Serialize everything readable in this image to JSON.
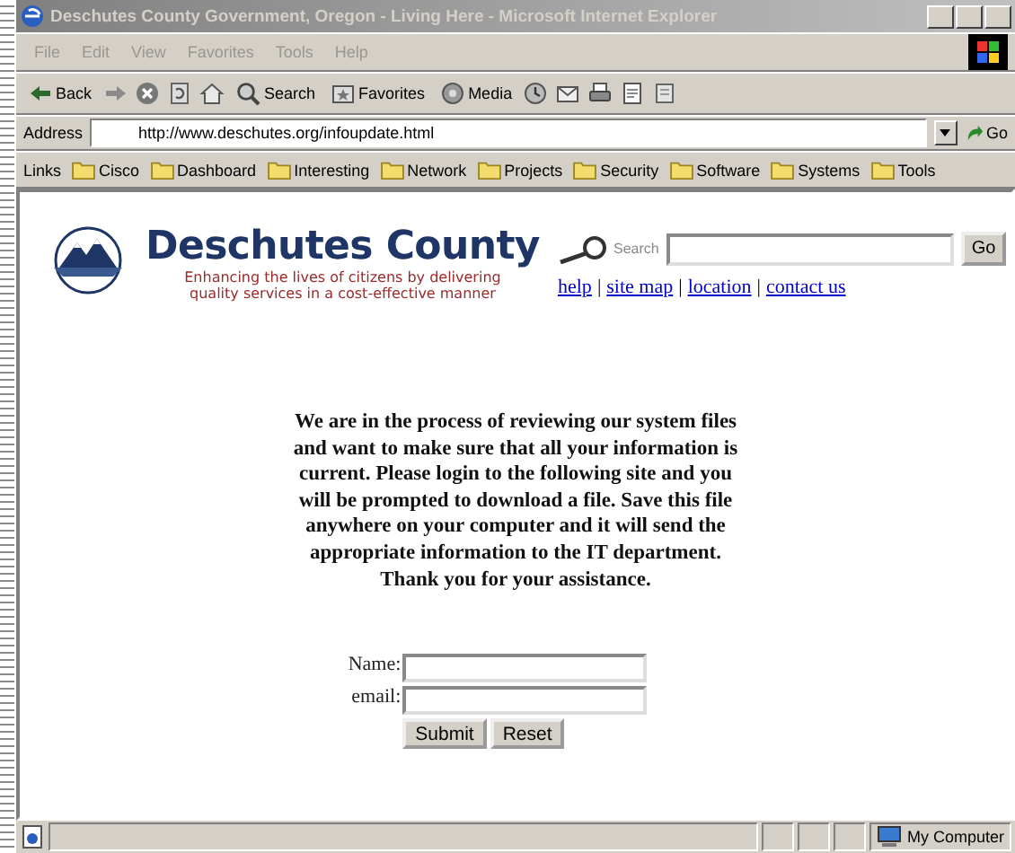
{
  "window": {
    "title": "Deschutes County Government, Oregon - Living Here - Microsoft Internet Explorer"
  },
  "menu": [
    "File",
    "Edit",
    "View",
    "Favorites",
    "Tools",
    "Help"
  ],
  "toolbar": [
    {
      "kind": "back",
      "label": "Back"
    },
    {
      "kind": "forward"
    },
    {
      "kind": "stop"
    },
    {
      "kind": "refresh"
    },
    {
      "kind": "home"
    },
    {
      "kind": "search",
      "label": "Search"
    },
    {
      "kind": "favorites",
      "label": "Favorites"
    },
    {
      "kind": "media",
      "label": "Media"
    },
    {
      "kind": "history"
    },
    {
      "kind": "mail"
    },
    {
      "kind": "print"
    },
    {
      "kind": "edit"
    },
    {
      "kind": "discuss"
    }
  ],
  "address": {
    "label": "Address",
    "value": "http://www.deschutes.org/infoupdate.html",
    "go": "Go"
  },
  "links": {
    "label": "Links",
    "items": [
      "Cisco",
      "Dashboard",
      "Interesting",
      "Network",
      "Projects",
      "Security",
      "Software",
      "Systems",
      "Tools"
    ]
  },
  "site": {
    "title": "Deschutes County",
    "tagline": [
      "Enhancing the lives of citizens by delivering",
      "quality services in a cost-effective manner"
    ],
    "search_label": "Search",
    "search_button": "Go",
    "links": [
      "help",
      "site map",
      "location",
      "contact us"
    ],
    "link_separator": "|"
  },
  "message": "We are in the process of reviewing our system files and want to make sure that all your information is current. Please login to the following site and you will be prompted to download a file. Save this file anywhere on your computer and it will send the appropriate information to the IT department. Thank you for your assistance.",
  "form": {
    "fields": [
      {
        "label": "Name:"
      },
      {
        "label": "email:"
      }
    ],
    "buttons": [
      "Submit",
      "Reset"
    ]
  },
  "status_bar": {
    "zone": "My Computer"
  }
}
